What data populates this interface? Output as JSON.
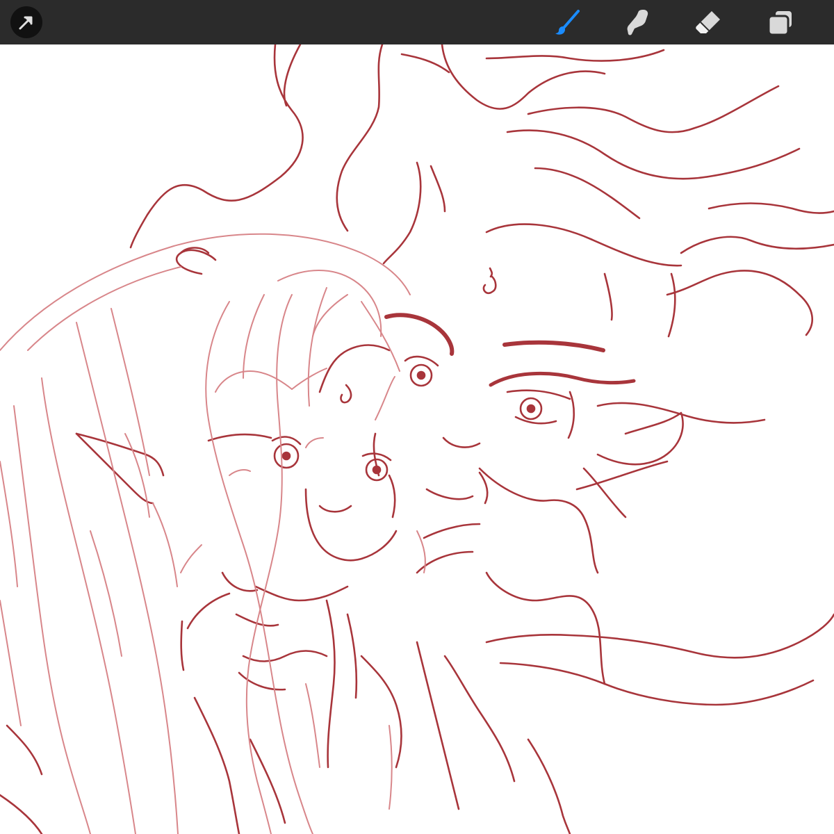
{
  "toolbar": {
    "tools": [
      {
        "name": "actions",
        "icon": "cursor-arrow-icon",
        "active": false
      },
      {
        "name": "paint",
        "icon": "brush-icon",
        "active": true
      },
      {
        "name": "smudge",
        "icon": "smudge-finger-icon",
        "active": false
      },
      {
        "name": "erase",
        "icon": "eraser-icon",
        "active": false
      },
      {
        "name": "layers",
        "icon": "layers-icon",
        "active": false
      }
    ]
  },
  "colors": {
    "toolbar_bg": "#2b2b2b",
    "icon": "#d9d9d9",
    "active_tool": "#1a8cff",
    "line_dark": "#9e2f35",
    "line_light": "#d8868a",
    "canvas_bg": "#ffffff"
  },
  "canvas": {
    "content": "sketch-drawing"
  }
}
